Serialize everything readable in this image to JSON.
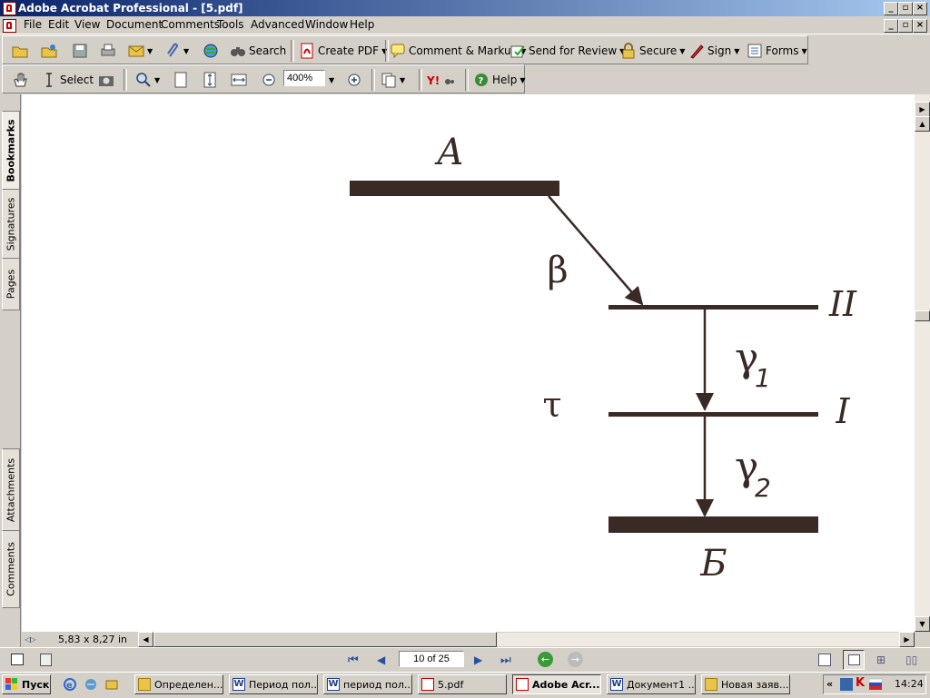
{
  "window": {
    "title": "Adobe Acrobat Professional - [5.pdf]"
  },
  "menu": [
    "File",
    "Edit",
    "View",
    "Document",
    "Comments",
    "Tools",
    "Advanced",
    "Window",
    "Help"
  ],
  "toolbar1": {
    "search": "Search",
    "create_pdf": "Create PDF",
    "comment_markup": "Comment & Markup",
    "send_review": "Send for Review",
    "secure": "Secure",
    "sign": "Sign",
    "forms": "Forms"
  },
  "toolbar2": {
    "select": "Select",
    "zoom": "400%",
    "help": "Help"
  },
  "nav_tabs": [
    "Bookmarks",
    "Signatures",
    "Pages",
    "Attachments",
    "Comments"
  ],
  "diagram": {
    "label_A": "A",
    "label_beta": "β",
    "label_II": "II",
    "label_gamma": "γ",
    "sub_1": "1",
    "label_tau": "τ",
    "label_I": "I",
    "sub_2": "2",
    "label_B": "Б"
  },
  "page_size": "5,83 x 8,27 in",
  "page_indicator": "10 of 25",
  "taskbar": {
    "start": "Пуск",
    "tasks": [
      "Определен...",
      "Период пол...",
      "период пол...",
      "5.pdf",
      "Adobe Acr...",
      "Документ1 ...",
      "Новая заяв..."
    ],
    "clock": "14:24",
    "chevron": "«"
  },
  "colors": {
    "diagram": "#3a2a25",
    "titlebar_start": "#0a246a",
    "titlebar_end": "#a6caf0"
  }
}
